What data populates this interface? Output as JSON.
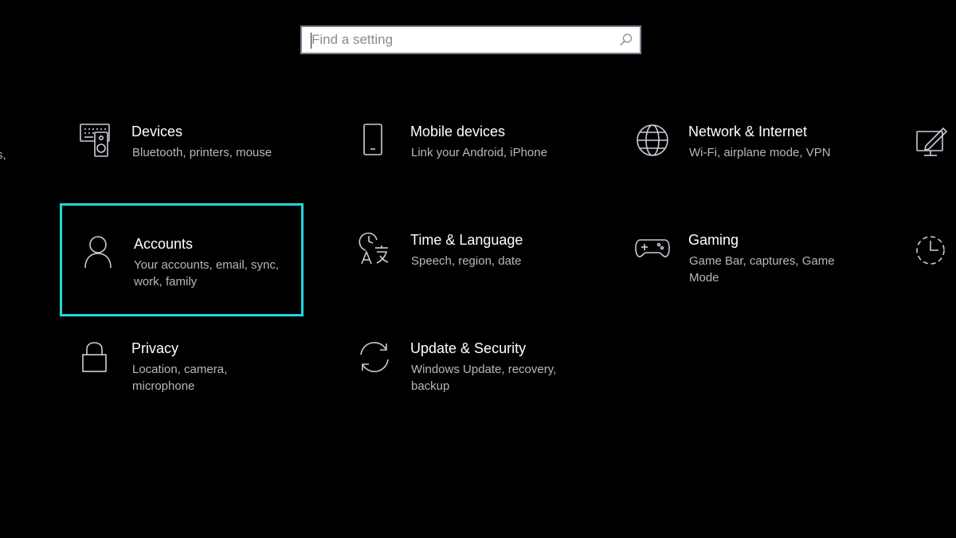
{
  "search": {
    "placeholder": "Find a setting",
    "icon": "search-icon"
  },
  "left_edge_text": "s,",
  "tiles": [
    {
      "title": "Devices",
      "desc": "Bluetooth, printers, mouse",
      "icon": "keyboard-speaker-icon"
    },
    {
      "title": "Mobile devices",
      "desc": "Link your Android, iPhone",
      "icon": "phone-icon"
    },
    {
      "title": "Network & Internet",
      "desc": "Wi-Fi, airplane mode, VPN",
      "icon": "globe-icon"
    },
    {
      "title": "Accounts",
      "desc": "Your accounts, email, sync, work, family",
      "icon": "person-icon",
      "selected": true
    },
    {
      "title": "Time & Language",
      "desc": "Speech, region, date",
      "icon": "time-language-icon"
    },
    {
      "title": "Gaming",
      "desc": "Game Bar, captures, Game Mode",
      "icon": "gamepad-icon"
    },
    {
      "title": "Privacy",
      "desc": "Location, camera, microphone",
      "icon": "lock-icon"
    },
    {
      "title": "Update & Security",
      "desc": "Windows Update, recovery, backup",
      "icon": "sync-arrows-icon"
    }
  ],
  "colors": {
    "background": "#000000",
    "selection_border": "#23d5d8",
    "title_text": "#ffffff",
    "desc_text": "#b8b8b8",
    "icon_stroke": "#c8cdd6"
  }
}
